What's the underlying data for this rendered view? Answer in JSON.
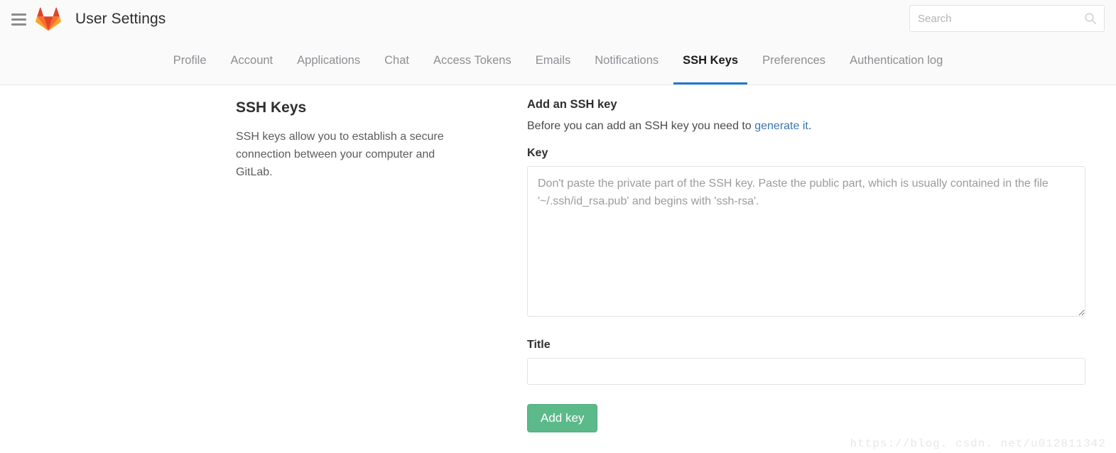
{
  "header": {
    "menu_icon": "hamburger-icon",
    "logo_icon": "gitlab-logo-icon",
    "title": "User Settings",
    "search": {
      "placeholder": "Search",
      "value": "",
      "icon": "search-icon"
    }
  },
  "nav": {
    "tabs": [
      {
        "label": "Profile",
        "active": false
      },
      {
        "label": "Account",
        "active": false
      },
      {
        "label": "Applications",
        "active": false
      },
      {
        "label": "Chat",
        "active": false
      },
      {
        "label": "Access Tokens",
        "active": false
      },
      {
        "label": "Emails",
        "active": false
      },
      {
        "label": "Notifications",
        "active": false
      },
      {
        "label": "SSH Keys",
        "active": true
      },
      {
        "label": "Preferences",
        "active": false
      },
      {
        "label": "Authentication log",
        "active": false
      }
    ],
    "active_underline_color": "#1f78d1"
  },
  "left_panel": {
    "title": "SSH Keys",
    "description": "SSH keys allow you to establish a secure connection between your computer and GitLab."
  },
  "form": {
    "heading": "Add an SSH key",
    "intro_prefix": "Before you can add an SSH key you need to ",
    "intro_link": "generate it",
    "intro_suffix": ".",
    "key_label": "Key",
    "key_placeholder": "Don't paste the private part of the SSH key. Paste the public part, which is usually contained in the file '~/.ssh/id_rsa.pub' and begins with 'ssh-rsa'.",
    "key_value": "",
    "title_label": "Title",
    "title_placeholder": "",
    "title_value": "",
    "submit_label": "Add key",
    "submit_color": "#5cb98a",
    "link_color": "#3777b0"
  },
  "watermark": {
    "text": "https://blog. csdn. net/u012811342"
  }
}
